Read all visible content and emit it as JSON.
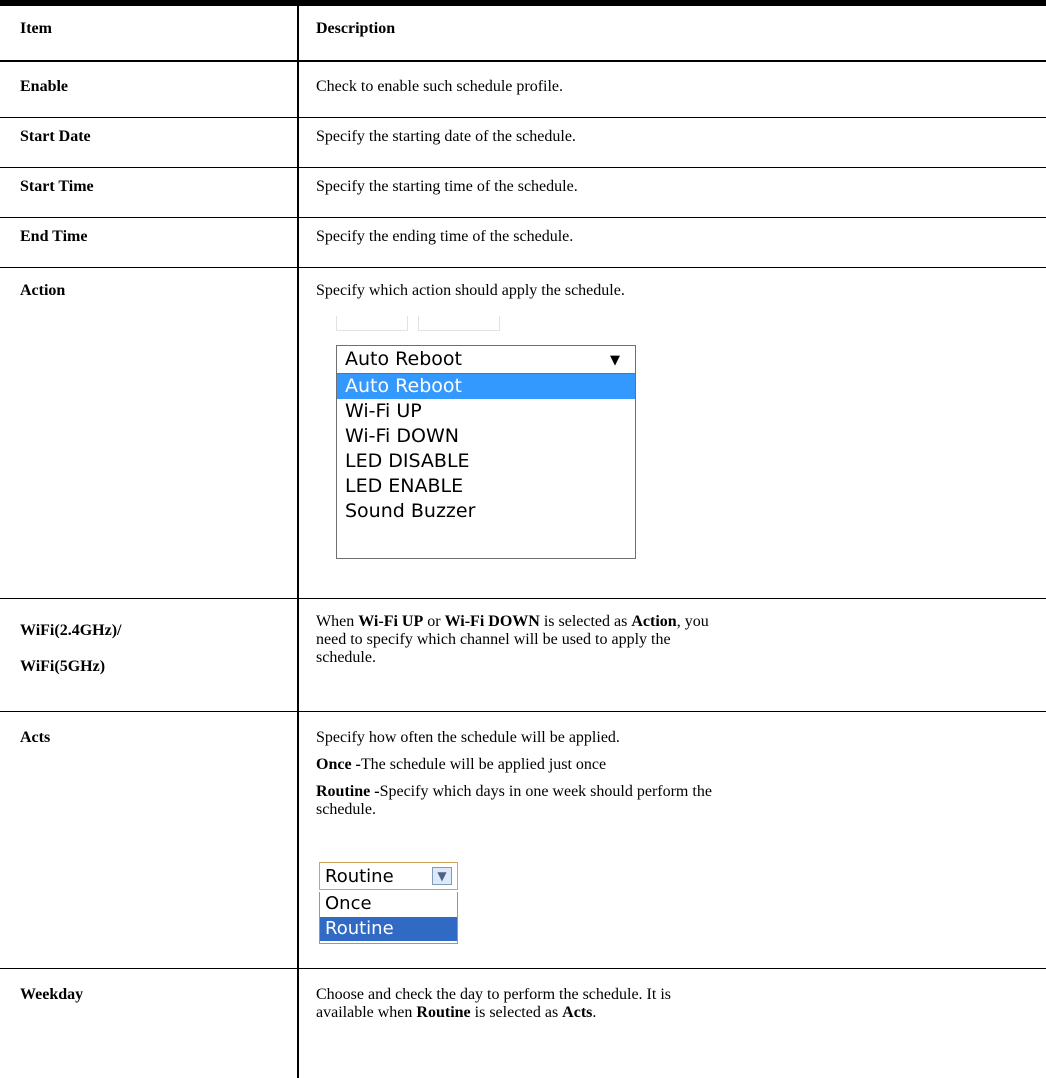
{
  "header": {
    "item": "Item",
    "description": "Description"
  },
  "rows": {
    "enable": {
      "item": "Enable",
      "desc": "Check to enable such schedule profile."
    },
    "start_date": {
      "item": "Start Date",
      "desc": "Specify the starting date of the schedule."
    },
    "start_time": {
      "item": "Start Time",
      "desc": "Specify the starting time of the schedule."
    },
    "end_time": {
      "item": "End Time",
      "desc": "Specify the ending time of the schedule."
    },
    "action": {
      "item": "Action",
      "desc": "Specify which action should apply the schedule.",
      "dropdown": {
        "selected": "Auto Reboot",
        "options": [
          "Auto Reboot",
          "Wi-Fi UP",
          "Wi-Fi DOWN",
          "LED DISABLE",
          "LED ENABLE",
          "Sound Buzzer"
        ]
      }
    },
    "wifi": {
      "item_line1": "WiFi(2.4GHz)/",
      "item_line2": "WiFi(5GHz)",
      "desc_a": "When ",
      "desc_b": "Wi-Fi UP",
      "desc_c": " or ",
      "desc_d": "Wi-Fi DOWN",
      "desc_e": " is selected as ",
      "desc_f": "Action",
      "desc_g": ", you",
      "desc_line2": "need to specify which channel will be used to apply the",
      "desc_line3": "schedule."
    },
    "acts": {
      "item": "Acts",
      "line1": "Specify how often the schedule will be applied.",
      "once_label": "Once -",
      "once_text": "The schedule will be applied just once",
      "routine_label": "Routine -",
      "routine_text": "Specify which days in one week should perform the",
      "routine_text2": "schedule.",
      "dropdown": {
        "selected": "Routine",
        "options": [
          "Once",
          "Routine"
        ]
      }
    },
    "weekday": {
      "item": "Weekday",
      "line1": "Choose and check the day to perform the schedule. It is",
      "line2_a": "available when ",
      "line2_b": "Routine",
      "line2_c": " is selected as ",
      "line2_d": "Acts",
      "line2_e": "."
    }
  },
  "colors": {
    "selected_option": "#3399ff",
    "acts_selected": "#316ac5",
    "acts_border": "#d2a35a"
  }
}
